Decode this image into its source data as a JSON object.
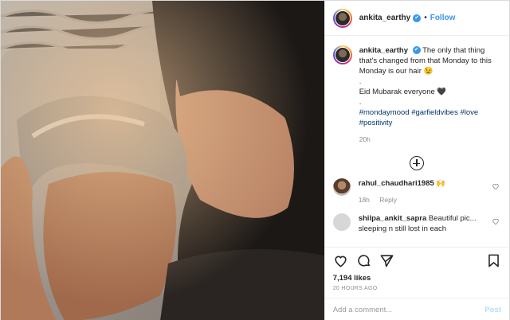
{
  "photo": {
    "description_icon": "photo"
  },
  "header": {
    "username": "ankita_earthy",
    "verified": "✔",
    "separator": "•",
    "follow_label": "Follow"
  },
  "caption": {
    "username": "ankita_earthy",
    "verified": "✔",
    "line1": "The only that thing that's changed from that Monday to this Monday is our hair 😉",
    "dot1": ".",
    "line2": "Eid Mubarak everyone 🖤",
    "dot2": ".",
    "hashtags": "#mondaymood #garfieldvibes #love #positivity",
    "time": "20h"
  },
  "comments": [
    {
      "username": "rahul_chaudhari1985",
      "text": "🙌",
      "time": "18h",
      "reply": "Reply"
    },
    {
      "username": "shilpa_ankit_sapra",
      "text": "Beautiful pic... sleeping n still lost in each"
    }
  ],
  "likes": "7,194 likes",
  "timestamp": "20 HOURS AGO",
  "add_comment": {
    "placeholder": "Add a comment...",
    "post_label": "Post"
  },
  "colors": {
    "accent": "#3897f0",
    "hashtag": "#003569",
    "muted": "#8e8e8e"
  }
}
